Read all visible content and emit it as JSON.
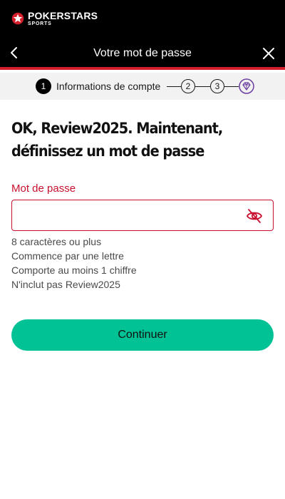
{
  "brand": {
    "name": "POKERSTARS",
    "sub": "SPORTS",
    "logo_icon": "star-icon",
    "accent_color": "#d41e2c"
  },
  "header": {
    "title": "Votre mot de passe",
    "back_icon": "chevron-left-icon",
    "close_icon": "close-icon"
  },
  "stepper": {
    "steps": [
      {
        "number": "1",
        "label": "Informations de compte",
        "state": "active"
      },
      {
        "number": "2",
        "state": "upcoming"
      },
      {
        "number": "3",
        "state": "upcoming"
      },
      {
        "icon": "diamond-icon",
        "state": "final"
      }
    ]
  },
  "main": {
    "heading": "OK, Review2025. Maintenant, définissez un mot de passe",
    "password_label": "Mot de passe",
    "password_value": "",
    "password_placeholder": "",
    "visibility_icon": "eye-off-icon",
    "rules": [
      "8 caractères ou plus",
      "Commence par une lettre",
      "Comporte au moins 1 chiffre",
      "N'inclut pas Review2025"
    ],
    "continue_label": "Continuer",
    "continue_color": "#00c295"
  }
}
